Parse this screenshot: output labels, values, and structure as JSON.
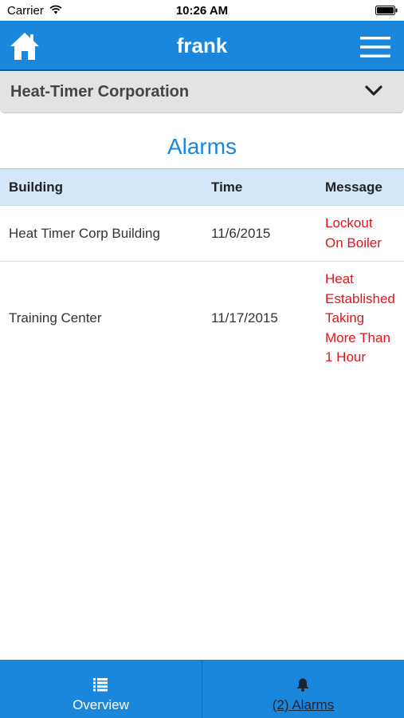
{
  "status_bar": {
    "carrier": "Carrier",
    "time": "10:26 AM"
  },
  "nav": {
    "title": "frank",
    "home_icon": "home-icon",
    "menu_icon": "menu-icon"
  },
  "selector": {
    "value": "Heat-Timer Corporation",
    "icon": "chevron-down-icon"
  },
  "page": {
    "title": "Alarms"
  },
  "table": {
    "headers": {
      "building": "Building",
      "time": "Time",
      "message": "Message"
    },
    "rows": [
      {
        "building": "Heat Timer Corp Building",
        "time": "11/6/2015",
        "message_lines": [
          "Lockout",
          "On Boiler"
        ]
      },
      {
        "building": "Training Center",
        "time": "11/17/2015",
        "message_lines": [
          "Heat",
          "Established",
          "Taking",
          "More Than",
          "1 Hour"
        ]
      }
    ]
  },
  "tabs": [
    {
      "label": "Overview",
      "icon": "list-icon"
    },
    {
      "label": "(2) Alarms",
      "icon": "bell-icon"
    }
  ],
  "colors": {
    "primary": "#1a87dc",
    "alarm_text": "#e3131b",
    "header_bg": "#d3e7f8",
    "selector_bg": "#e3e3e3"
  }
}
